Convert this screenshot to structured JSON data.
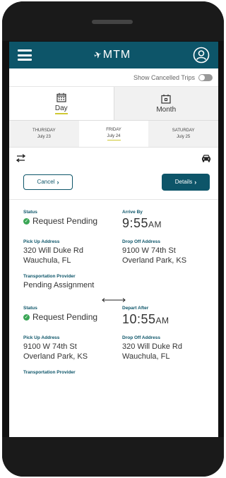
{
  "header": {
    "logo_text": "MTM"
  },
  "filters": {
    "show_cancelled_label": "Show Cancelled Trips"
  },
  "view_tabs": [
    {
      "label": "Day",
      "active": true
    },
    {
      "label": "Month",
      "active": false
    }
  ],
  "dates": [
    {
      "day": "THURSDAY",
      "date": "July 23",
      "active": false
    },
    {
      "day": "FRIDAY",
      "date": "July 24",
      "active": true
    },
    {
      "day": "SATURDAY",
      "date": "July 25",
      "active": false
    }
  ],
  "actions": {
    "cancel_label": "Cancel",
    "details_label": "Details"
  },
  "trips": [
    {
      "status_label": "Status",
      "status_value": "Request Pending",
      "time_label": "Arrive By",
      "time_value": "9:55",
      "time_ampm": "AM",
      "pickup_label": "Pick Up Address",
      "pickup_line1": "320 Will Duke Rd",
      "pickup_line2": "Wauchula, FL",
      "dropoff_label": "Drop Off Address",
      "dropoff_line1": "9100 W 74th St",
      "dropoff_line2": "Overland Park, KS",
      "provider_label": "Transportation Provider",
      "provider_value": "Pending Assignment"
    },
    {
      "status_label": "Status",
      "status_value": "Request Pending",
      "time_label": "Depart After",
      "time_value": "10:55",
      "time_ampm": "AM",
      "pickup_label": "Pick Up Address",
      "pickup_line1": "9100 W 74th St",
      "pickup_line2": "Overland Park, KS",
      "dropoff_label": "Drop Off Address",
      "dropoff_line1": "320 Will Duke Rd",
      "dropoff_line2": "Wauchula, FL",
      "provider_label": "Transportation Provider"
    }
  ],
  "colors": {
    "brand": "#0d5569",
    "accent_underline": "#cfc832",
    "status_green": "#3aa655"
  }
}
